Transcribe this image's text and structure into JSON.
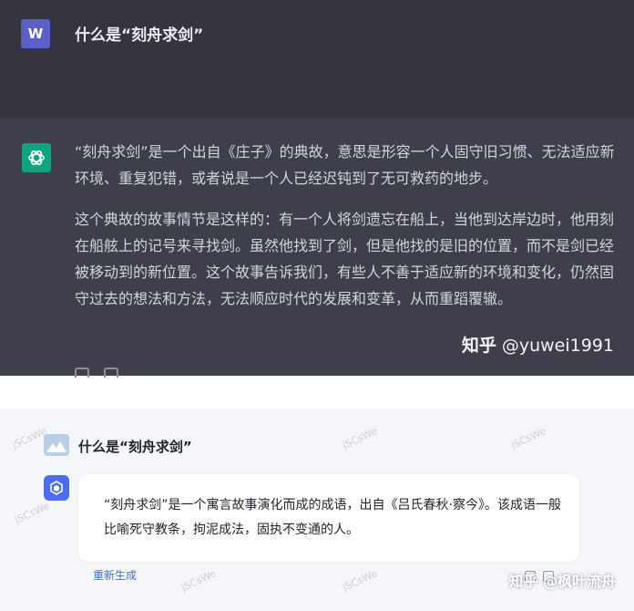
{
  "chatgpt": {
    "user_avatar_letter": "W",
    "question": "什么是“刻舟求剑”",
    "answer_paragraphs": [
      "“刻舟求剑”是一个出自《庄子》的典故，意思是形容一个人固守旧习惯、无法适应新环境、重复犯错，或者说是一个人已经迟钝到了无可救药的地步。",
      "这个典故的故事情节是这样的：有一个人将剑遗忘在船上，当他到达岸边时，他用刻在船舷上的记号来寻找剑。虽然他找到了剑，但是他找的是旧的位置，而不是剑已经被移动到的新位置。这个故事告诉我们，有些人不善于适应新的环境和变化，仍然固守过去的想法和方法，无法顺应时代的发展和变革，从而重蹈覆辙。"
    ],
    "watermark_cn": "知乎",
    "watermark_user": "@yuwei1991",
    "colors": {
      "panel_bg": "#3e3f4b",
      "user_row_bg": "#34353f",
      "avatar": "#5b5fc7",
      "logo": "#10a37f"
    }
  },
  "ernie": {
    "question": "什么是“刻舟求剑”",
    "answer": "“刻舟求剑”是一个寓言故事演化而成的成语，出自《吕氏春秋·察今》。该成语一般比喻死守教条，拘泥成法，固执不变通的人。",
    "regenerate_label": "重新生成",
    "watermark": "知乎 @枫叶流舟",
    "background_watermark": "jSCsWe",
    "colors": {
      "panel_bg": "#f5f6f9",
      "bot_icon": "#4d6df0",
      "link": "#3370ff"
    }
  }
}
